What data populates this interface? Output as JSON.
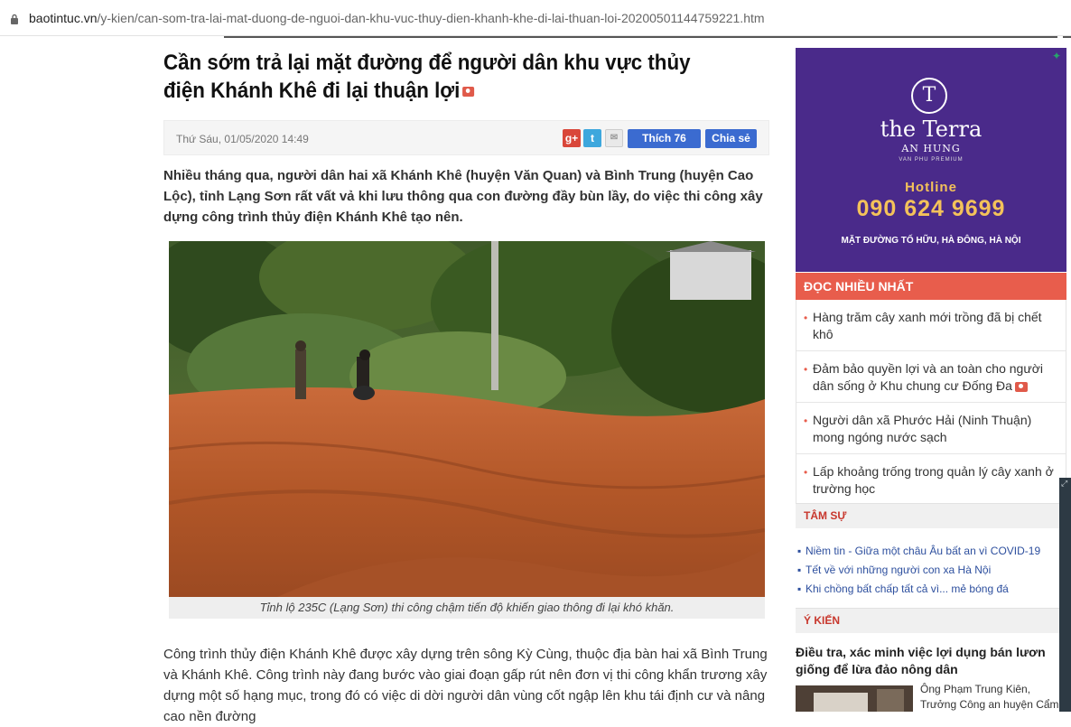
{
  "browser": {
    "url_domain": "baotintuc.vn",
    "url_path": "/y-kien/can-som-tra-lai-mat-duong-de-nguoi-dan-khu-vuc-thuy-dien-khanh-khe-di-lai-thuan-loi-20200501144759221.htm",
    "lock_icon": "lock-icon"
  },
  "article": {
    "title": "Cần sớm trả lại mặt đường để người dân khu vực thủy điện Khánh Khê đi lại thuận lợi",
    "date": "Thứ Sáu, 01/05/2020 14:49",
    "share": {
      "like_label": "Thích 76",
      "share_label": "Chia sẻ",
      "google_label": "g+",
      "twitter_label": "t",
      "mail_label": "✉"
    },
    "lead": "Nhiều tháng qua, người dân hai xã Khánh Khê (huyện Văn Quan) và Bình Trung (huyện Cao Lộc), tỉnh Lạng Sơn rất vất vả khi lưu thông qua con đường đầy bùn lầy, do việc thi công xây dựng công trình thủy điện Khánh Khê tạo nên.",
    "photo_caption": "Tỉnh lộ 235C (Lạng Sơn) thi công chậm tiến độ khiến giao thông đi lại khó khăn.",
    "body": "Công trình thủy điện Khánh Khê được xây dựng trên sông Kỳ Cùng, thuộc địa bàn hai xã Bình Trung và Khánh Khê. Công trình này đang bước vào giai đoạn gấp rút nên đơn vị thi công khẩn trương xây dựng một số hạng mục, trong đó có việc di dời người dân vùng cốt ngập lên khu tái định cư và nâng cao nền đường"
  },
  "sidebar": {
    "ad": {
      "logo_letter": "T",
      "brand": "the Terra",
      "sub": "AN HUNG",
      "sub2": "VAN PHU PREMIUM",
      "hotline_label": "Hotline",
      "phone": "090 624 9699",
      "address": "MẶT ĐƯỜNG TỐ HỮU, HÀ ĐÔNG, HÀ NỘI"
    },
    "most_read": {
      "heading": "ĐỌC NHIỀU NHẤT",
      "items": [
        "Hàng trăm cây xanh mới trồng đã bị chết khô",
        "Đảm bảo quyền lợi và an toàn cho người dân sống ở Khu chung cư Đống Đa",
        "Người dân xã Phước Hải (Ninh Thuận) mong ngóng nước sạch",
        "Lấp khoảng trống trong quản lý cây xanh ở trường học"
      ]
    },
    "tam_su": {
      "heading": "TÂM SỰ",
      "items": [
        "Niềm tin - Giữa một châu Âu bất an vì COVID-19",
        "Tết về với những người con xa Hà Nội",
        "Khi chồng bất chấp tất cả vì... mẻ bóng đá"
      ]
    },
    "y_kien": {
      "heading": "Ý KIẾN",
      "title": "Điều tra, xác minh việc lợi dụng bán lươn giống để lừa đảo nông dân",
      "author": "Ông Phạm Trung Kiên, Trưởng Công an huyện Cẩm"
    }
  },
  "colors": {
    "accent_red": "#e85d4c",
    "link_blue": "#2d4f9e",
    "facebook_blue": "#3b6bd0",
    "ad_purple": "#4a2a8a",
    "ad_gold": "#f4c25a"
  }
}
